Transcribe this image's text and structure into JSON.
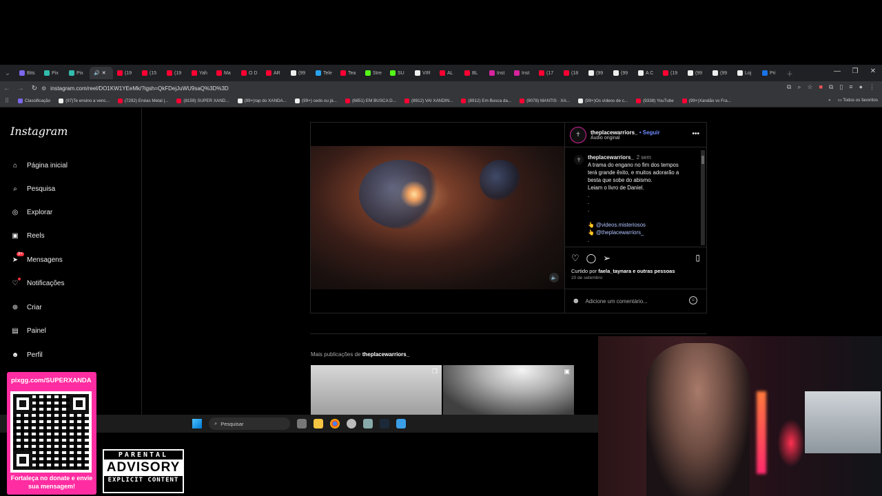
{
  "browser": {
    "tabs": [
      {
        "label": "Bits",
        "color": "#7b68ee"
      },
      {
        "label": "Pix",
        "color": "#32bcad"
      },
      {
        "label": "Pix",
        "color": "#32bcad"
      },
      {
        "label": "(19",
        "color": "#ff0033"
      },
      {
        "label": "(15",
        "color": "#ff0033"
      },
      {
        "label": "(19",
        "color": "#ff0033"
      },
      {
        "label": "Yah",
        "color": "#ff0033"
      },
      {
        "label": "Ma",
        "color": "#ff0033"
      },
      {
        "label": "O D",
        "color": "#ff0033"
      },
      {
        "label": "AR",
        "color": "#ff0033"
      },
      {
        "label": "(99",
        "color": "#eeeeee"
      },
      {
        "label": "Tele",
        "color": "#2aa3ef"
      },
      {
        "label": "Tea",
        "color": "#ff0033"
      },
      {
        "label": "Stre",
        "color": "#53fc18"
      },
      {
        "label": "SU",
        "color": "#53fc18"
      },
      {
        "label": "VIR",
        "color": "#eeeeee"
      },
      {
        "label": "AL",
        "color": "#ff0033"
      },
      {
        "label": "BL",
        "color": "#ff0033"
      },
      {
        "label": "Inst",
        "color": "#d6249f"
      },
      {
        "label": "Inst",
        "color": "#d6249f"
      },
      {
        "label": "(17",
        "color": "#ff0033"
      },
      {
        "label": "(18",
        "color": "#ff0033"
      },
      {
        "label": "(99",
        "color": "#eeeeee"
      },
      {
        "label": "(99",
        "color": "#eeeeee"
      },
      {
        "label": "A C",
        "color": "#eeeeee"
      },
      {
        "label": "(19",
        "color": "#ff0033"
      },
      {
        "label": "(99",
        "color": "#eeeeee"
      },
      {
        "label": "(99",
        "color": "#eeeeee"
      },
      {
        "label": "Loj",
        "color": "#eeeeee"
      },
      {
        "label": "Pri",
        "color": "#1a73e8"
      }
    ],
    "active_tab_label": "",
    "url": "instagram.com/reel/DO1KW1YEeMk/?igsh=QkFDejJuWU9saQ%3D%3D",
    "bookmarks": [
      {
        "label": "Classificação",
        "color": "#7b68ee"
      },
      {
        "label": "(97)Te ensino a venc...",
        "color": "#eeeeee"
      },
      {
        "label": "(7292) Enéas Metal |...",
        "color": "#ff0033"
      },
      {
        "label": "(8159) SUPER XAND...",
        "color": "#ff0033"
      },
      {
        "label": "(99+)rap do XANDÃ...",
        "color": "#eeeeee"
      },
      {
        "label": "(99+) cedo ou já...",
        "color": "#eeeeee"
      },
      {
        "label": "(8851) EM BUSCA D...",
        "color": "#ff0033"
      },
      {
        "label": "(8912) VAI XANDIN...",
        "color": "#ff0033"
      },
      {
        "label": "(8912) Em Busca da...",
        "color": "#ff0033"
      },
      {
        "label": "(9078) MANTIS · XA...",
        "color": "#ff0033"
      },
      {
        "label": "(99+)Os vídeos de c...",
        "color": "#eeeeee"
      },
      {
        "label": "(9338) YouTube",
        "color": "#ff0033"
      },
      {
        "label": "(99+)Xandão vs Fra...",
        "color": "#ff0033"
      }
    ],
    "all_bookmarks": "Todos os favoritos"
  },
  "instagram": {
    "logo": "Instagram",
    "nav": [
      {
        "name": "home",
        "label": "Página inicial",
        "icon": "⌂"
      },
      {
        "name": "search",
        "label": "Pesquisa",
        "icon": "⌕"
      },
      {
        "name": "explore",
        "label": "Explorar",
        "icon": "◎"
      },
      {
        "name": "reels",
        "label": "Reels",
        "icon": "▣"
      },
      {
        "name": "messages",
        "label": "Mensagens",
        "icon": "➤",
        "badge": "9+"
      },
      {
        "name": "notifications",
        "label": "Notificações",
        "icon": "♡",
        "dot": true
      },
      {
        "name": "create",
        "label": "Criar",
        "icon": "⊕"
      },
      {
        "name": "dashboard",
        "label": "Painel",
        "icon": "▤"
      },
      {
        "name": "profile",
        "label": "Perfil",
        "icon": "☻"
      }
    ],
    "post": {
      "username": "theplacewarriors_",
      "follow": "Seguir",
      "audio": "Áudio original",
      "caption_user": "theplacewarriors_",
      "caption_time": "2 sem",
      "caption_lines": [
        "A trama do engano no fim dos tempos",
        "terá grande êxito, e muitos adorarão a",
        "besta que sobe do abismo.",
        "Leiam o livro de Daniel."
      ],
      "mention_1": "@videos.misteriosos",
      "mention_2": "@theplacewarriors_",
      "liked_prefix": "Curtido por",
      "liked_user": "faela_taynara",
      "liked_suffix": "e outras pessoas",
      "date": "20 de setembro",
      "comment_placeholder": "Adicione um comentário..."
    },
    "more_prefix": "Mais publicações de",
    "more_user": "theplacewarriors_"
  },
  "taskbar": {
    "search_label": "Pesquisar"
  },
  "overlay": {
    "pix_url": "pixgg.com/SUPERXANDA",
    "pix_message": "Fortaleça no donate e envie sua mensagem!",
    "advisory_top": "PARENTAL",
    "advisory_mid": "ADVISORY",
    "advisory_bottom": "EXPLICIT CONTENT"
  }
}
